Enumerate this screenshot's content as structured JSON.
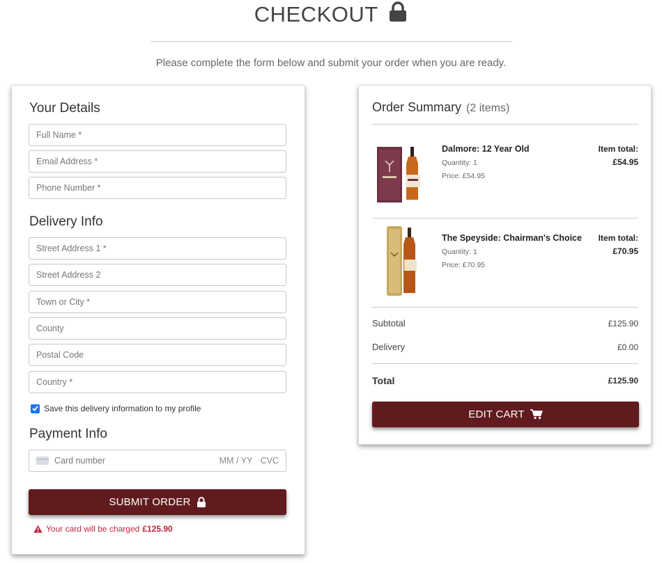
{
  "page": {
    "title": "CHECKOUT",
    "subtitle": "Please complete the form below and submit your order when you are ready."
  },
  "form": {
    "your_details": {
      "title": "Your Details",
      "full_name_placeholder": "Full Name *",
      "email_placeholder": "Email Address *",
      "phone_placeholder": "Phone Number *"
    },
    "delivery": {
      "title": "Delivery Info",
      "street1_placeholder": "Street Address 1 *",
      "street2_placeholder": "Street Address 2",
      "town_placeholder": "Town or City *",
      "county_placeholder": "County",
      "postal_placeholder": "Postal Code",
      "country_placeholder": "Country *",
      "save_label": "Save this delivery information to my profile",
      "save_checked": true
    },
    "payment": {
      "title": "Payment Info",
      "card_number_placeholder": "Card number",
      "expiry_placeholder": "MM / YY",
      "cvc_placeholder": "CVC"
    },
    "submit_label": "SUBMIT ORDER",
    "charge_text": "Your card will be charged",
    "charge_amount": "£125.90"
  },
  "summary": {
    "title": "Order Summary",
    "count": "(2 items)",
    "items": [
      {
        "name": "Dalmore: 12 Year Old",
        "quantity": "Quantity: 1",
        "price": "Price: £54.95",
        "total_label": "Item total:",
        "total": "£54.95"
      },
      {
        "name": "The Speyside: Chairman's Choice",
        "quantity": "Quantity: 1",
        "price": "Price: £70.95",
        "total_label": "Item total:",
        "total": "£70.95"
      }
    ],
    "subtotal_label": "Subtotal",
    "subtotal": "£125.90",
    "delivery_label": "Delivery",
    "delivery": "£0.00",
    "total_label": "Total",
    "total": "£125.90",
    "edit_label": "EDIT CART"
  },
  "colors": {
    "button": "#611b1e",
    "error": "#c0253b",
    "checkbox": "#1a73e8"
  },
  "icons": [
    "lock-icon",
    "cart-icon",
    "warning-icon",
    "credit-card-icon",
    "checkmark-icon"
  ]
}
